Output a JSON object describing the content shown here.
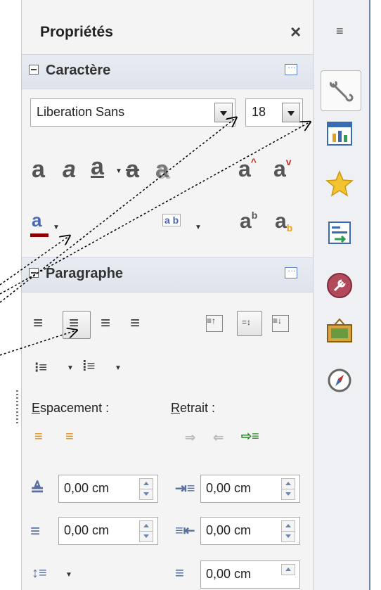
{
  "deck": {
    "title": "Propriétés",
    "close": "×"
  },
  "character": {
    "title": "Caractère",
    "font_name": "Liberation Sans",
    "font_size": "18"
  },
  "paragraph": {
    "title": "Paragraphe",
    "spacing_label_pre": "E",
    "spacing_label_post": "spacement :",
    "indent_label_pre": "R",
    "indent_label_post": "etrait :",
    "above": "0,00 cm",
    "below": "0,00 cm",
    "before_text": "0,00 cm",
    "after_text": "0,00 cm",
    "first_line": "0,00 cm"
  },
  "tabbar": {
    "menu": "≡"
  }
}
